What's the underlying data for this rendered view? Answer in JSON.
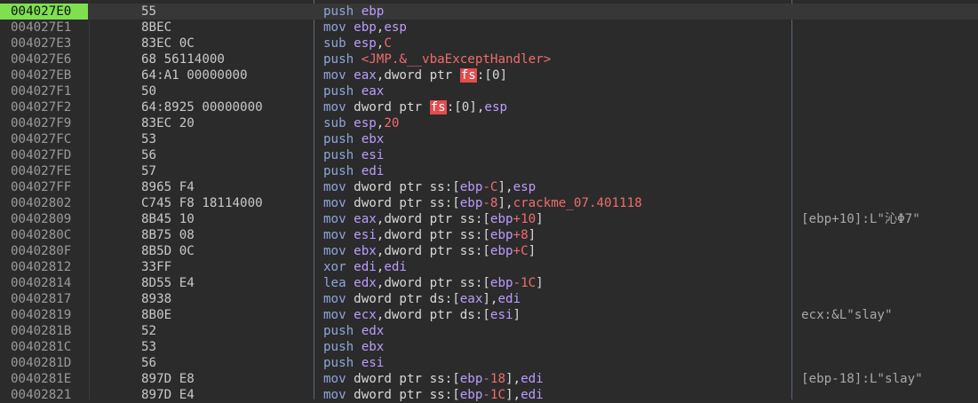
{
  "disasm": {
    "current_address": "004027E0",
    "rows": [
      {
        "addr": "004027E0",
        "bytes": "55",
        "instr": [
          [
            "mnem",
            "push"
          ],
          [
            "txt",
            " "
          ],
          [
            "reg",
            "ebp"
          ]
        ],
        "comment": ""
      },
      {
        "addr": "004027E1",
        "bytes": "8BEC",
        "instr": [
          [
            "mnem",
            "mov"
          ],
          [
            "txt",
            " "
          ],
          [
            "reg",
            "ebp"
          ],
          [
            "txt",
            ","
          ],
          [
            "reg",
            "esp"
          ]
        ],
        "comment": ""
      },
      {
        "addr": "004027E3",
        "bytes": "83EC 0C",
        "instr": [
          [
            "mnem",
            "sub"
          ],
          [
            "txt",
            " "
          ],
          [
            "reg",
            "esp"
          ],
          [
            "txt",
            ","
          ],
          [
            "num",
            "C"
          ]
        ],
        "comment": ""
      },
      {
        "addr": "004027E6",
        "bytes": "68 56114000",
        "instr": [
          [
            "mnem",
            "push"
          ],
          [
            "txt",
            " "
          ],
          [
            "sym",
            "<JMP.&__vbaExceptHandler>"
          ]
        ],
        "comment": ""
      },
      {
        "addr": "004027EB",
        "bytes": "64:A1 00000000",
        "instr": [
          [
            "mnem",
            "mov"
          ],
          [
            "txt",
            " "
          ],
          [
            "reg",
            "eax"
          ],
          [
            "txt",
            ",dword ptr "
          ],
          [
            "fs",
            "fs"
          ],
          [
            "txt",
            ":[0]"
          ]
        ],
        "comment": ""
      },
      {
        "addr": "004027F1",
        "bytes": "50",
        "instr": [
          [
            "mnem",
            "push"
          ],
          [
            "txt",
            " "
          ],
          [
            "reg",
            "eax"
          ]
        ],
        "comment": ""
      },
      {
        "addr": "004027F2",
        "bytes": "64:8925 00000000",
        "instr": [
          [
            "mnem",
            "mov"
          ],
          [
            "txt",
            " dword ptr "
          ],
          [
            "fs",
            "fs"
          ],
          [
            "txt",
            ":[0],"
          ],
          [
            "reg",
            "esp"
          ]
        ],
        "comment": ""
      },
      {
        "addr": "004027F9",
        "bytes": "83EC 20",
        "instr": [
          [
            "mnem",
            "sub"
          ],
          [
            "txt",
            " "
          ],
          [
            "reg",
            "esp"
          ],
          [
            "txt",
            ","
          ],
          [
            "num",
            "20"
          ]
        ],
        "comment": ""
      },
      {
        "addr": "004027FC",
        "bytes": "53",
        "instr": [
          [
            "mnem",
            "push"
          ],
          [
            "txt",
            " "
          ],
          [
            "reg",
            "ebx"
          ]
        ],
        "comment": ""
      },
      {
        "addr": "004027FD",
        "bytes": "56",
        "instr": [
          [
            "mnem",
            "push"
          ],
          [
            "txt",
            " "
          ],
          [
            "reg",
            "esi"
          ]
        ],
        "comment": ""
      },
      {
        "addr": "004027FE",
        "bytes": "57",
        "instr": [
          [
            "mnem",
            "push"
          ],
          [
            "txt",
            " "
          ],
          [
            "reg",
            "edi"
          ]
        ],
        "comment": ""
      },
      {
        "addr": "004027FF",
        "bytes": "8965 F4",
        "instr": [
          [
            "mnem",
            "mov"
          ],
          [
            "txt",
            " dword ptr ss:["
          ],
          [
            "reg",
            "ebp"
          ],
          [
            "num",
            "-C"
          ],
          [
            "txt",
            "],"
          ],
          [
            "reg",
            "esp"
          ]
        ],
        "comment": ""
      },
      {
        "addr": "00402802",
        "bytes": "C745 F8 18114000",
        "instr": [
          [
            "mnem",
            "mov"
          ],
          [
            "txt",
            " dword ptr ss:["
          ],
          [
            "reg",
            "ebp"
          ],
          [
            "num",
            "-8"
          ],
          [
            "txt",
            "],"
          ],
          [
            "sym",
            "crackme_07.401118"
          ]
        ],
        "comment": ""
      },
      {
        "addr": "00402809",
        "bytes": "8B45 10",
        "instr": [
          [
            "mnem",
            "mov"
          ],
          [
            "txt",
            " "
          ],
          [
            "reg",
            "eax"
          ],
          [
            "txt",
            ",dword ptr ss:["
          ],
          [
            "reg",
            "ebp"
          ],
          [
            "num",
            "+10"
          ],
          [
            "txt",
            "]"
          ]
        ],
        "comment": "[ebp+10]:L\"沁Φ7\""
      },
      {
        "addr": "0040280C",
        "bytes": "8B75 08",
        "instr": [
          [
            "mnem",
            "mov"
          ],
          [
            "txt",
            " "
          ],
          [
            "reg",
            "esi"
          ],
          [
            "txt",
            ",dword ptr ss:["
          ],
          [
            "reg",
            "ebp"
          ],
          [
            "num",
            "+8"
          ],
          [
            "txt",
            "]"
          ]
        ],
        "comment": ""
      },
      {
        "addr": "0040280F",
        "bytes": "8B5D 0C",
        "instr": [
          [
            "mnem",
            "mov"
          ],
          [
            "txt",
            " "
          ],
          [
            "reg",
            "ebx"
          ],
          [
            "txt",
            ",dword ptr ss:["
          ],
          [
            "reg",
            "ebp"
          ],
          [
            "num",
            "+C"
          ],
          [
            "txt",
            "]"
          ]
        ],
        "comment": ""
      },
      {
        "addr": "00402812",
        "bytes": "33FF",
        "instr": [
          [
            "mnem",
            "xor"
          ],
          [
            "txt",
            " "
          ],
          [
            "reg",
            "edi"
          ],
          [
            "txt",
            ","
          ],
          [
            "reg",
            "edi"
          ]
        ],
        "comment": ""
      },
      {
        "addr": "00402814",
        "bytes": "8D55 E4",
        "instr": [
          [
            "mnem",
            "lea"
          ],
          [
            "txt",
            " "
          ],
          [
            "reg",
            "edx"
          ],
          [
            "txt",
            ",dword ptr ss:["
          ],
          [
            "reg",
            "ebp"
          ],
          [
            "num",
            "-1C"
          ],
          [
            "txt",
            "]"
          ]
        ],
        "comment": ""
      },
      {
        "addr": "00402817",
        "bytes": "8938",
        "instr": [
          [
            "mnem",
            "mov"
          ],
          [
            "txt",
            " dword ptr ds:["
          ],
          [
            "reg",
            "eax"
          ],
          [
            "txt",
            "],"
          ],
          [
            "reg",
            "edi"
          ]
        ],
        "comment": ""
      },
      {
        "addr": "00402819",
        "bytes": "8B0E",
        "instr": [
          [
            "mnem",
            "mov"
          ],
          [
            "txt",
            " "
          ],
          [
            "reg",
            "ecx"
          ],
          [
            "txt",
            ",dword ptr ds:["
          ],
          [
            "reg",
            "esi"
          ],
          [
            "txt",
            "]"
          ]
        ],
        "comment": "ecx:&L\"slay\""
      },
      {
        "addr": "0040281B",
        "bytes": "52",
        "instr": [
          [
            "mnem",
            "push"
          ],
          [
            "txt",
            " "
          ],
          [
            "reg",
            "edx"
          ]
        ],
        "comment": ""
      },
      {
        "addr": "0040281C",
        "bytes": "53",
        "instr": [
          [
            "mnem",
            "push"
          ],
          [
            "txt",
            " "
          ],
          [
            "reg",
            "ebx"
          ]
        ],
        "comment": ""
      },
      {
        "addr": "0040281D",
        "bytes": "56",
        "instr": [
          [
            "mnem",
            "push"
          ],
          [
            "txt",
            " "
          ],
          [
            "reg",
            "esi"
          ]
        ],
        "comment": ""
      },
      {
        "addr": "0040281E",
        "bytes": "897D E8",
        "instr": [
          [
            "mnem",
            "mov"
          ],
          [
            "txt",
            " dword ptr ss:["
          ],
          [
            "reg",
            "ebp"
          ],
          [
            "num",
            "-18"
          ],
          [
            "txt",
            "],"
          ],
          [
            "reg",
            "edi"
          ]
        ],
        "comment": "[ebp-18]:L\"slay\""
      },
      {
        "addr": "00402821",
        "bytes": "897D E4",
        "instr": [
          [
            "mnem",
            "mov"
          ],
          [
            "txt",
            " dword ptr ss:["
          ],
          [
            "reg",
            "ebp"
          ],
          [
            "num",
            "-1C"
          ],
          [
            "txt",
            "],"
          ],
          [
            "reg",
            "edi"
          ]
        ],
        "comment": ""
      }
    ]
  }
}
